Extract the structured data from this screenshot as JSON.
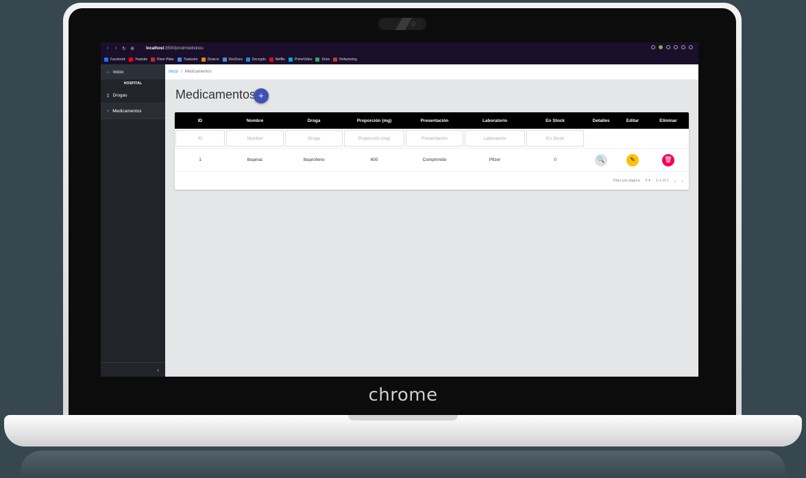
{
  "laptop": {
    "brand": "chrome"
  },
  "browser": {
    "url_host": "localhost",
    "url_path": ":3500/prod/medicines",
    "nav_icons": [
      "back-icon",
      "forward-icon",
      "reload-icon",
      "site-info-icon"
    ],
    "bookmarks": [
      {
        "label": "Facebook",
        "color": "#1877f2"
      },
      {
        "label": "Youtube",
        "color": "#ff0000"
      },
      {
        "label": "River Plate",
        "color": "#c62828"
      },
      {
        "label": "Traductor",
        "color": "#4285f4"
      },
      {
        "label": "Draw.io",
        "color": "#f08705"
      },
      {
        "label": "DevDocs",
        "color": "#4a90d9"
      },
      {
        "label": "Decrypto",
        "color": "#1e88e5"
      },
      {
        "label": "Netflix",
        "color": "#e50914"
      },
      {
        "label": "PrimeVideo",
        "color": "#00a8e1"
      },
      {
        "label": "Drive",
        "color": "#34a853"
      },
      {
        "label": "Refactoring",
        "color": "#c0392b"
      }
    ]
  },
  "sidebar": {
    "home_label": "Inicio",
    "section": "HOSPITAL",
    "items": [
      {
        "label": "Drogas",
        "icon": "document-icon"
      },
      {
        "label": "Medicamentos",
        "icon": "pills-icon"
      }
    ],
    "collapse_icon": "‹"
  },
  "breadcrumb": {
    "home": "Inicio",
    "separator": "/",
    "current": "Medicamentos"
  },
  "page": {
    "title": "Medicamentos",
    "add_label": "+"
  },
  "table": {
    "columns": [
      "ID",
      "Nombre",
      "Droga",
      "Proporción (mg)",
      "Presentación",
      "Laboratorio",
      "En Stock",
      "Detalles",
      "Editar",
      "Eliminar"
    ],
    "filters": [
      "ID",
      "Nombre",
      "Droga",
      "Proporción (mg)",
      "Presentación",
      "Laboratorio",
      "En Stock"
    ],
    "rows": [
      {
        "id": "1",
        "nombre": "Ibupirac",
        "droga": "Ibuprofeno",
        "proporcion": "600",
        "presentacion": "Comprimido",
        "laboratorio": "Pfizer",
        "stock": "0"
      }
    ],
    "pagination": {
      "rows_label": "Filas por página",
      "rows_value": "5",
      "range": "1-1 of 1"
    }
  },
  "colors": {
    "accent": "#3f51b5",
    "edit": "#ffc107",
    "delete": "#f50057",
    "sidebar": "#212429",
    "browser": "#1a0f2b"
  }
}
